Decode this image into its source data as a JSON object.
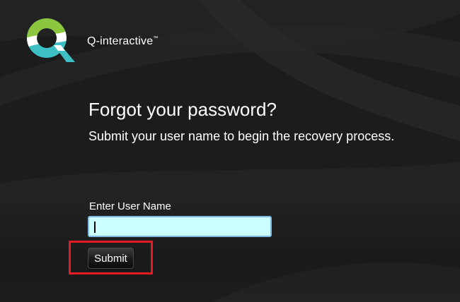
{
  "brand": {
    "logo_icon": "q-interactive-logo-icon",
    "name": "Q-interactive",
    "trademark": "™"
  },
  "heading": {
    "title": "Forgot your password?",
    "subtitle": "Submit your user name to begin the recovery process."
  },
  "form": {
    "username_label": "Enter User Name",
    "username_value": "",
    "username_placeholder": "",
    "submit_label": "Submit"
  },
  "colors": {
    "background": "#1c1c1c",
    "input_background": "#ccffff",
    "input_border": "#7fb9e6",
    "highlight": "#e51b24",
    "logo_green": "#8cc63f",
    "logo_teal": "#3dbfc4",
    "logo_white": "#ffffff"
  }
}
